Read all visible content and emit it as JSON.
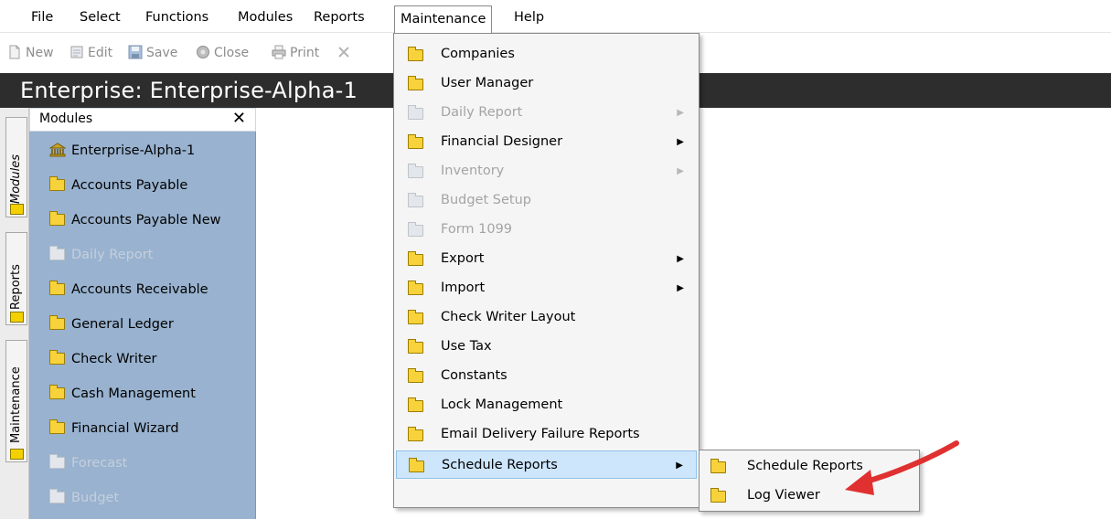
{
  "menubar": {
    "items": [
      "File",
      "Select",
      "Functions",
      "Modules",
      "Reports",
      "Maintenance",
      "Help"
    ]
  },
  "toolbar": {
    "new_label": "New",
    "edit_label": "Edit",
    "save_label": "Save",
    "close_label": "Close",
    "print_label": "Print"
  },
  "title": "Enterprise: Enterprise-Alpha-1",
  "vtabs": [
    "Modules",
    "Reports",
    "Maintenance"
  ],
  "modules_panel": {
    "header": "Modules",
    "close_glyph": "✕",
    "items": [
      {
        "label": "Enterprise-Alpha-1",
        "icon": "building-icon",
        "enabled": true
      },
      {
        "label": "Accounts Payable",
        "icon": "folder-icon",
        "enabled": true
      },
      {
        "label": "Accounts Payable New",
        "icon": "folder-icon",
        "enabled": true
      },
      {
        "label": "Daily Report",
        "icon": "folder-icon",
        "enabled": false
      },
      {
        "label": "Accounts Receivable",
        "icon": "folder-icon",
        "enabled": true
      },
      {
        "label": "General Ledger",
        "icon": "folder-icon",
        "enabled": true
      },
      {
        "label": "Check Writer",
        "icon": "folder-icon",
        "enabled": true
      },
      {
        "label": "Cash Management",
        "icon": "folder-icon",
        "enabled": true
      },
      {
        "label": "Financial Wizard",
        "icon": "folder-icon",
        "enabled": true
      },
      {
        "label": "Forecast",
        "icon": "folder-icon",
        "enabled": false
      },
      {
        "label": "Budget",
        "icon": "folder-icon",
        "enabled": false
      }
    ]
  },
  "maintenance_menu": {
    "items": [
      {
        "label": "Companies",
        "enabled": true,
        "submenu": false
      },
      {
        "label": "User Manager",
        "enabled": true,
        "submenu": false
      },
      {
        "label": "Daily Report",
        "enabled": false,
        "submenu": true
      },
      {
        "label": "Financial Designer",
        "enabled": true,
        "submenu": true
      },
      {
        "label": "Inventory",
        "enabled": false,
        "submenu": true
      },
      {
        "label": "Budget Setup",
        "enabled": false,
        "submenu": false
      },
      {
        "label": "Form 1099",
        "enabled": false,
        "submenu": false
      },
      {
        "label": "Export",
        "enabled": true,
        "submenu": true
      },
      {
        "label": "Import",
        "enabled": true,
        "submenu": true
      },
      {
        "label": "Check Writer Layout",
        "enabled": true,
        "submenu": false
      },
      {
        "label": "Use Tax",
        "enabled": true,
        "submenu": false
      },
      {
        "label": "Constants",
        "enabled": true,
        "submenu": false
      },
      {
        "label": "Lock Management",
        "enabled": true,
        "submenu": false
      },
      {
        "label": "Email Delivery Failure Reports",
        "enabled": true,
        "submenu": false
      },
      {
        "label": "Schedule Reports",
        "enabled": true,
        "submenu": true,
        "selected": true
      }
    ]
  },
  "schedule_submenu": {
    "items": [
      "Schedule Reports",
      "Log Viewer"
    ]
  },
  "colors": {
    "title_bar": "#2d2d2d",
    "modules_panel": "#98b2cf",
    "menu_highlight": "#cde6fb",
    "annotation_arrow": "#e03030",
    "folder": "#f7d23a"
  }
}
